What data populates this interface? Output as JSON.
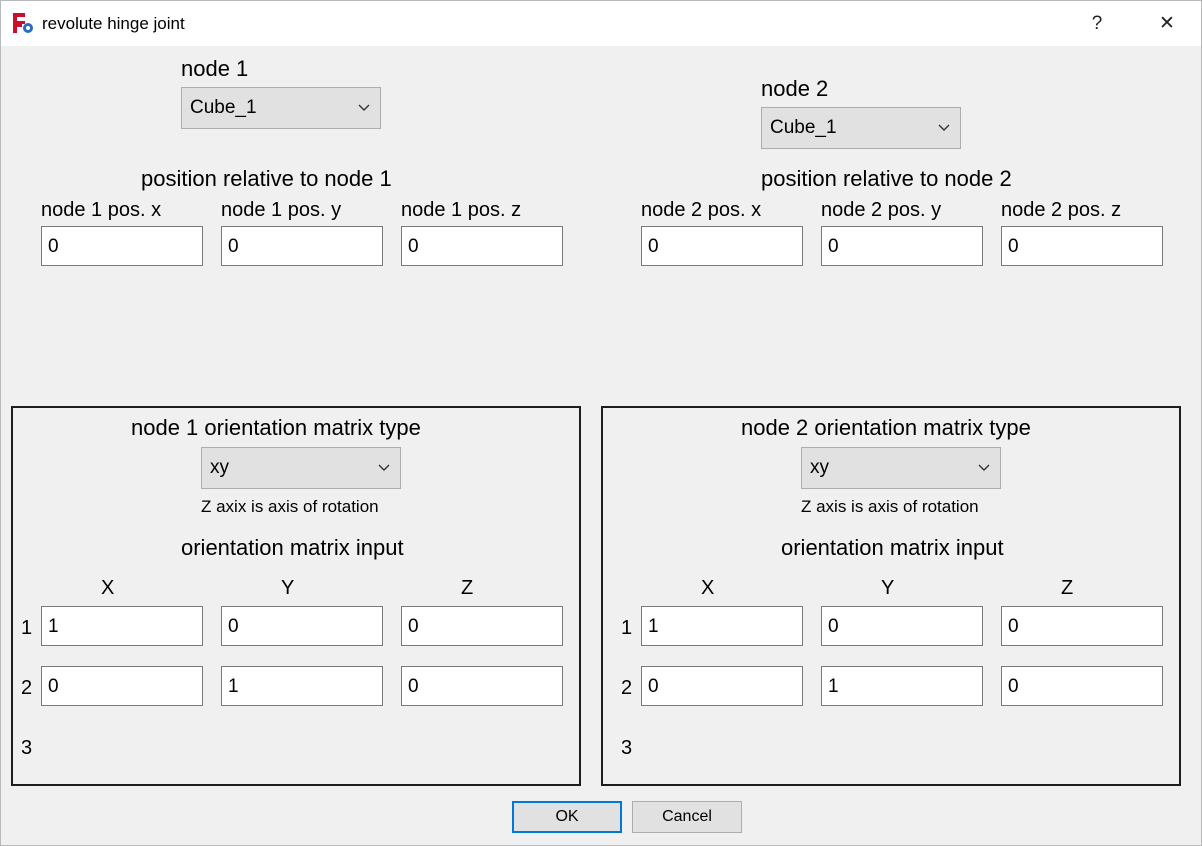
{
  "window": {
    "title": "revolute hinge joint",
    "help_glyph": "?",
    "close_glyph": "✕"
  },
  "node1": {
    "label": "node 1",
    "selected": "Cube_1",
    "position_label": "position relative to node 1",
    "pos_x_label": "node 1 pos. x",
    "pos_y_label": "node 1 pos. y",
    "pos_z_label": "node 1 pos. z",
    "pos_x": "0",
    "pos_y": "0",
    "pos_z": "0",
    "orientation": {
      "type_label": "node 1 orientation matrix type",
      "type_selected": "xy",
      "hint": "Z axix is axis of rotation",
      "input_label": "orientation matrix input",
      "col_x": "X",
      "col_y": "Y",
      "col_z": "Z",
      "row1": "1",
      "row2": "2",
      "row3": "3",
      "m11": "1",
      "m12": "0",
      "m13": "0",
      "m21": "0",
      "m22": "1",
      "m23": "0"
    }
  },
  "node2": {
    "label": "node 2",
    "selected": "Cube_1",
    "position_label": "position relative to node 2",
    "pos_x_label": "node 2 pos. x",
    "pos_y_label": "node 2 pos. y",
    "pos_z_label": "node 2 pos. z",
    "pos_x": "0",
    "pos_y": "0",
    "pos_z": "0",
    "orientation": {
      "type_label": "node 2 orientation matrix type",
      "type_selected": "xy",
      "hint": "Z axis is axis of rotation",
      "input_label": "orientation matrix input",
      "col_x": "X",
      "col_y": "Y",
      "col_z": "Z",
      "row1": "1",
      "row2": "2",
      "row3": "3",
      "m11": "1",
      "m12": "0",
      "m13": "0",
      "m21": "0",
      "m22": "1",
      "m23": "0"
    }
  },
  "buttons": {
    "ok": "OK",
    "cancel": "Cancel"
  },
  "colors": {
    "focus_border": "#0078d7",
    "app_icon_red": "#c8102e",
    "app_icon_blue": "#2a6cc4"
  },
  "icons": {
    "app": "freecad-app-icon",
    "help": "help-icon",
    "close": "close-icon",
    "dropdown": "chevron-down-icon"
  }
}
